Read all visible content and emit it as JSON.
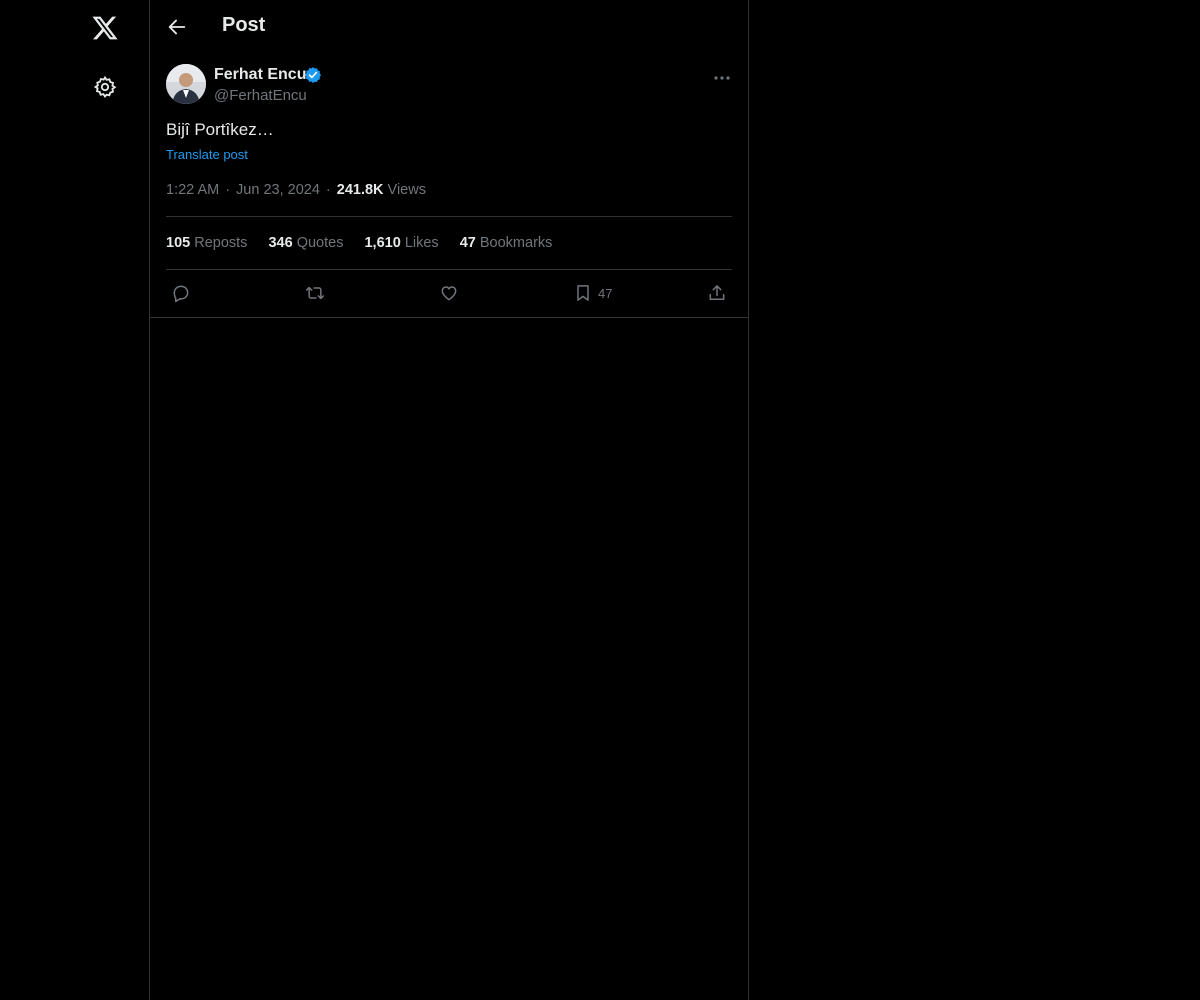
{
  "header": {
    "title": "Post"
  },
  "tweet": {
    "display_name": "Ferhat Encu",
    "handle": "@FerhatEncu",
    "text": "Bijî Portîkez…",
    "translate_label": "Translate post",
    "time": "1:22 AM",
    "separator": "·",
    "date": "Jun 23, 2024",
    "views_count": "241.8K",
    "views_label": "Views"
  },
  "stats": {
    "reposts_count": "105",
    "reposts_label": "Reposts",
    "quotes_count": "346",
    "quotes_label": "Quotes",
    "likes_count": "1,610",
    "likes_label": "Likes",
    "bookmarks_count": "47",
    "bookmarks_label": "Bookmarks"
  },
  "actions": {
    "bookmark_count": "47"
  },
  "icons": {
    "logo": "x-logo-icon",
    "settings": "gear-icon",
    "back": "arrow-left-icon",
    "verified": "verified-badge-icon",
    "more": "more-horizontal-icon",
    "reply": "reply-icon",
    "repost": "repost-icon",
    "like": "heart-icon",
    "bookmark": "bookmark-icon",
    "share": "share-icon"
  },
  "colors": {
    "background": "#000000",
    "text_primary": "#e7e9ea",
    "text_secondary": "#71767b",
    "accent": "#1d9bf0",
    "border": "#2f3336"
  }
}
